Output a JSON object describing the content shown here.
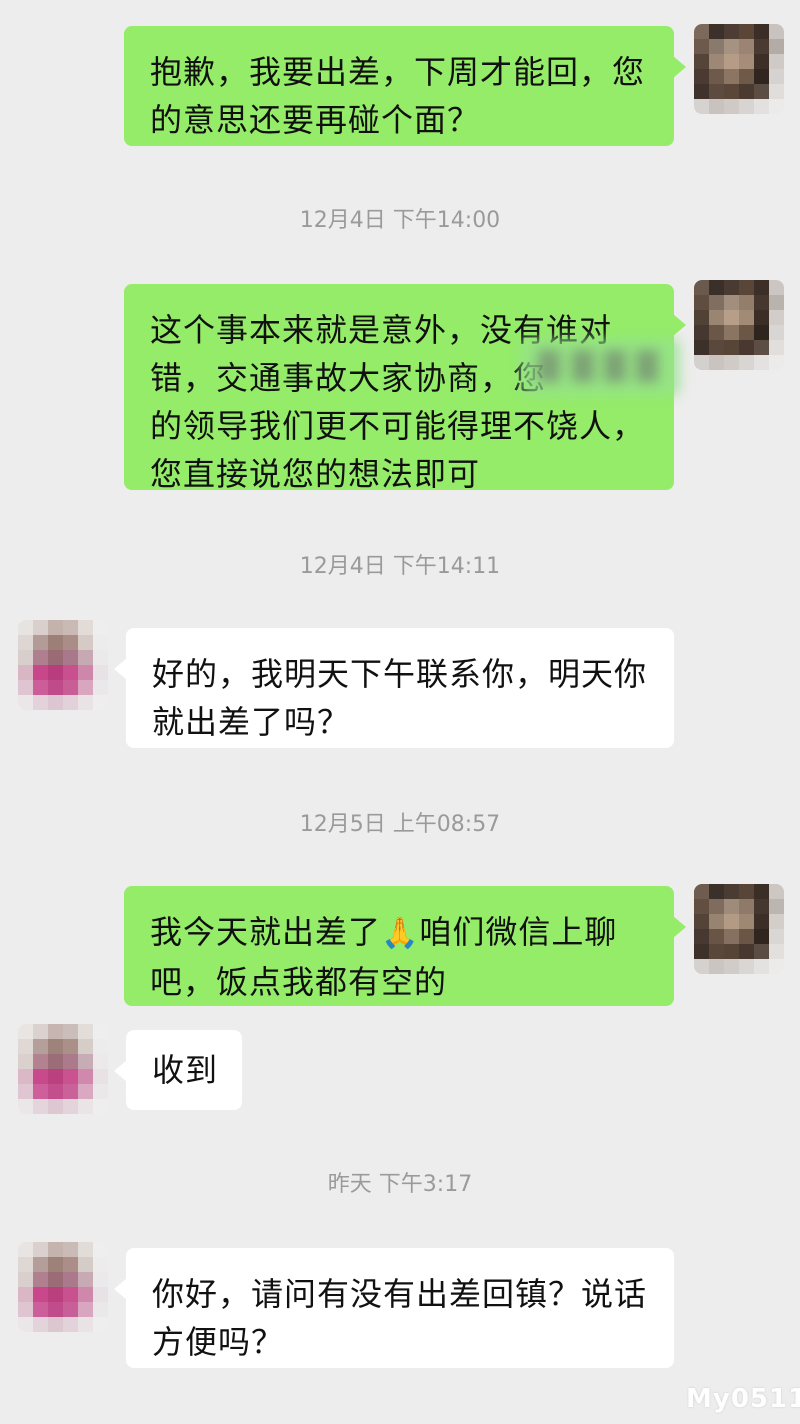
{
  "messages": [
    {
      "text": "抱歉，我要出差，下周才能回，您\n的意思还要再碰个面？"
    },
    {
      "timestamp": "12月4日 下午14:00"
    },
    {
      "text": "这个事本来就是意外，没有谁对\n错，交通事故大家协商，您\n的领导我们更不可能得理不饶人，\n您直接说您的想法即可"
    },
    {
      "timestamp": "12月4日 下午14:11"
    },
    {
      "text": "好的，我明天下午联系你，明天你\n就出差了吗？"
    },
    {
      "timestamp": "12月5日 上午08:57"
    },
    {
      "text_before_emoji": "我今天就出差了",
      "emoji": "🙏",
      "text_after_emoji": "咱们微信上聊\n吧，饭点我都有空的"
    },
    {
      "text": "收到"
    },
    {
      "timestamp": "昨天 下午3:17"
    },
    {
      "text": "你好，请问有没有出差回镇？说话\n方便吗？"
    }
  ],
  "colors": {
    "background": "#ededed",
    "own_bubble": "#95ec69",
    "other_bubble": "#ffffff",
    "timestamp": "#9a9a9a"
  },
  "icons": {
    "own_avatar": "pixelated-avatar-icon",
    "other_avatar": "pixelated-avatar-icon",
    "emoji": "folded-hands-emoji"
  },
  "watermark": "My0511"
}
